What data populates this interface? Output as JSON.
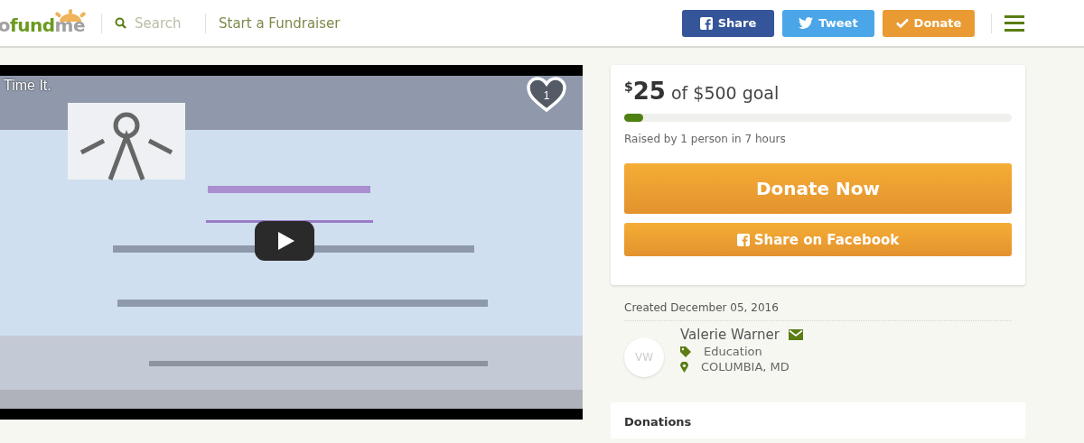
{
  "header": {
    "logo": [
      {
        "text": "o",
        "kind": "plain"
      },
      {
        "text": "fund",
        "kind": "accent"
      },
      {
        "text": "me",
        "kind": "plain"
      }
    ],
    "search": {
      "placeholder": "Search"
    },
    "start_link": "Start a Fundraiser",
    "buttons": [
      {
        "label": "Share",
        "kind": "facebook"
      },
      {
        "label": "Tweet",
        "kind": "twitter"
      },
      {
        "label": "Donate",
        "kind": "donate"
      }
    ]
  },
  "video": {
    "title": "Time It.",
    "likes": "1"
  },
  "progress": {
    "currency": "$",
    "amount": "25",
    "goal": "of $500 goal",
    "level": 0.05,
    "raised": "Raised by 1 person in 7 hours"
  },
  "actions": [
    {
      "label": "Donate Now",
      "kind": "primary"
    },
    {
      "label": "Share on Facebook",
      "kind": "facebook"
    }
  ],
  "created": "Created December 05, 2016",
  "organizer": {
    "initials": "VW",
    "name": "Valerie Warner",
    "category": "Education",
    "location": "COLUMBIA, MD"
  },
  "donations": {
    "title": "Donations"
  }
}
